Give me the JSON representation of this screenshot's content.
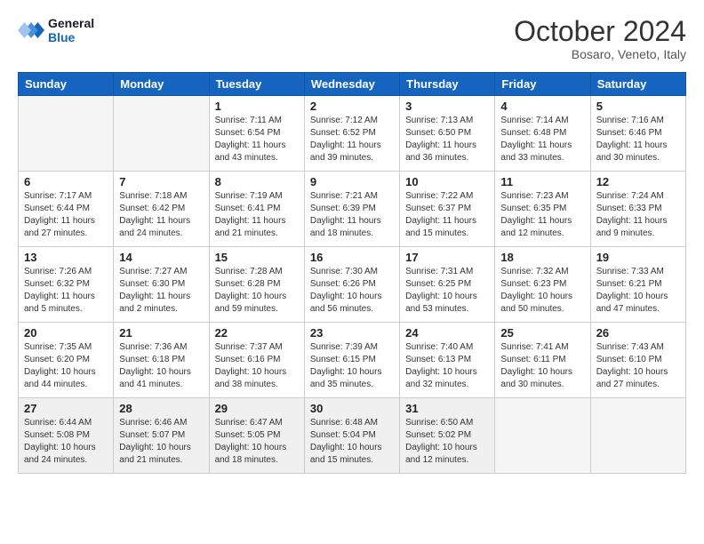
{
  "header": {
    "logo_line1": "General",
    "logo_line2": "Blue",
    "month": "October 2024",
    "location": "Bosaro, Veneto, Italy"
  },
  "weekdays": [
    "Sunday",
    "Monday",
    "Tuesday",
    "Wednesday",
    "Thursday",
    "Friday",
    "Saturday"
  ],
  "weeks": [
    [
      {
        "day": "",
        "info": ""
      },
      {
        "day": "",
        "info": ""
      },
      {
        "day": "1",
        "info": "Sunrise: 7:11 AM\nSunset: 6:54 PM\nDaylight: 11 hours\nand 43 minutes."
      },
      {
        "day": "2",
        "info": "Sunrise: 7:12 AM\nSunset: 6:52 PM\nDaylight: 11 hours\nand 39 minutes."
      },
      {
        "day": "3",
        "info": "Sunrise: 7:13 AM\nSunset: 6:50 PM\nDaylight: 11 hours\nand 36 minutes."
      },
      {
        "day": "4",
        "info": "Sunrise: 7:14 AM\nSunset: 6:48 PM\nDaylight: 11 hours\nand 33 minutes."
      },
      {
        "day": "5",
        "info": "Sunrise: 7:16 AM\nSunset: 6:46 PM\nDaylight: 11 hours\nand 30 minutes."
      }
    ],
    [
      {
        "day": "6",
        "info": "Sunrise: 7:17 AM\nSunset: 6:44 PM\nDaylight: 11 hours\nand 27 minutes."
      },
      {
        "day": "7",
        "info": "Sunrise: 7:18 AM\nSunset: 6:42 PM\nDaylight: 11 hours\nand 24 minutes."
      },
      {
        "day": "8",
        "info": "Sunrise: 7:19 AM\nSunset: 6:41 PM\nDaylight: 11 hours\nand 21 minutes."
      },
      {
        "day": "9",
        "info": "Sunrise: 7:21 AM\nSunset: 6:39 PM\nDaylight: 11 hours\nand 18 minutes."
      },
      {
        "day": "10",
        "info": "Sunrise: 7:22 AM\nSunset: 6:37 PM\nDaylight: 11 hours\nand 15 minutes."
      },
      {
        "day": "11",
        "info": "Sunrise: 7:23 AM\nSunset: 6:35 PM\nDaylight: 11 hours\nand 12 minutes."
      },
      {
        "day": "12",
        "info": "Sunrise: 7:24 AM\nSunset: 6:33 PM\nDaylight: 11 hours\nand 9 minutes."
      }
    ],
    [
      {
        "day": "13",
        "info": "Sunrise: 7:26 AM\nSunset: 6:32 PM\nDaylight: 11 hours\nand 5 minutes."
      },
      {
        "day": "14",
        "info": "Sunrise: 7:27 AM\nSunset: 6:30 PM\nDaylight: 11 hours\nand 2 minutes."
      },
      {
        "day": "15",
        "info": "Sunrise: 7:28 AM\nSunset: 6:28 PM\nDaylight: 10 hours\nand 59 minutes."
      },
      {
        "day": "16",
        "info": "Sunrise: 7:30 AM\nSunset: 6:26 PM\nDaylight: 10 hours\nand 56 minutes."
      },
      {
        "day": "17",
        "info": "Sunrise: 7:31 AM\nSunset: 6:25 PM\nDaylight: 10 hours\nand 53 minutes."
      },
      {
        "day": "18",
        "info": "Sunrise: 7:32 AM\nSunset: 6:23 PM\nDaylight: 10 hours\nand 50 minutes."
      },
      {
        "day": "19",
        "info": "Sunrise: 7:33 AM\nSunset: 6:21 PM\nDaylight: 10 hours\nand 47 minutes."
      }
    ],
    [
      {
        "day": "20",
        "info": "Sunrise: 7:35 AM\nSunset: 6:20 PM\nDaylight: 10 hours\nand 44 minutes."
      },
      {
        "day": "21",
        "info": "Sunrise: 7:36 AM\nSunset: 6:18 PM\nDaylight: 10 hours\nand 41 minutes."
      },
      {
        "day": "22",
        "info": "Sunrise: 7:37 AM\nSunset: 6:16 PM\nDaylight: 10 hours\nand 38 minutes."
      },
      {
        "day": "23",
        "info": "Sunrise: 7:39 AM\nSunset: 6:15 PM\nDaylight: 10 hours\nand 35 minutes."
      },
      {
        "day": "24",
        "info": "Sunrise: 7:40 AM\nSunset: 6:13 PM\nDaylight: 10 hours\nand 32 minutes."
      },
      {
        "day": "25",
        "info": "Sunrise: 7:41 AM\nSunset: 6:11 PM\nDaylight: 10 hours\nand 30 minutes."
      },
      {
        "day": "26",
        "info": "Sunrise: 7:43 AM\nSunset: 6:10 PM\nDaylight: 10 hours\nand 27 minutes."
      }
    ],
    [
      {
        "day": "27",
        "info": "Sunrise: 6:44 AM\nSunset: 5:08 PM\nDaylight: 10 hours\nand 24 minutes."
      },
      {
        "day": "28",
        "info": "Sunrise: 6:46 AM\nSunset: 5:07 PM\nDaylight: 10 hours\nand 21 minutes."
      },
      {
        "day": "29",
        "info": "Sunrise: 6:47 AM\nSunset: 5:05 PM\nDaylight: 10 hours\nand 18 minutes."
      },
      {
        "day": "30",
        "info": "Sunrise: 6:48 AM\nSunset: 5:04 PM\nDaylight: 10 hours\nand 15 minutes."
      },
      {
        "day": "31",
        "info": "Sunrise: 6:50 AM\nSunset: 5:02 PM\nDaylight: 10 hours\nand 12 minutes."
      },
      {
        "day": "",
        "info": ""
      },
      {
        "day": "",
        "info": ""
      }
    ]
  ]
}
